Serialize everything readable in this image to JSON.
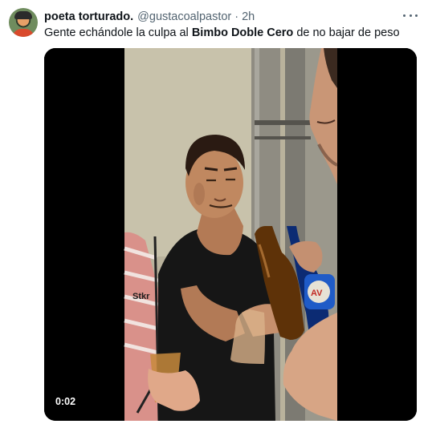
{
  "tweet": {
    "author_name": "poeta torturado.",
    "author_handle": "@gustacoalpastor",
    "separator": "·",
    "time": "2h",
    "text_before": "Gente echándole la culpa al ",
    "text_bold": "Bimbo Doble Cero",
    "text_after": " de no bajar de peso"
  },
  "media": {
    "type": "video",
    "timestamp": "0:02",
    "shirt_text": "Stkr",
    "can_text": "AV"
  },
  "icons": {
    "more": "more-horizontal-icon"
  },
  "colors": {
    "text_primary": "#0f1419",
    "text_secondary": "#536471",
    "video_bg": "#000000"
  }
}
